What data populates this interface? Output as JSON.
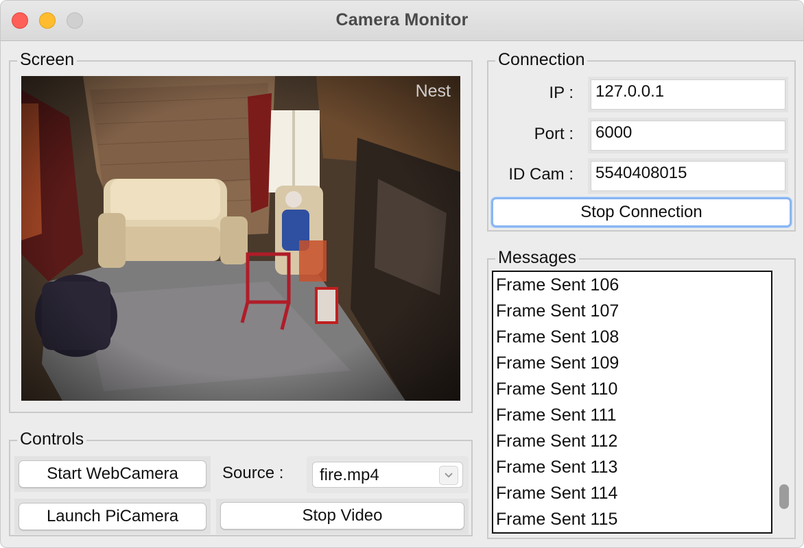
{
  "window": {
    "title": "Camera Monitor"
  },
  "screen": {
    "label": "Screen",
    "watermark": "Nest"
  },
  "controls": {
    "label": "Controls",
    "start_webcam": "Start WebCamera",
    "launch_picamera": "Launch PiCamera",
    "source_label": "Source :",
    "source_value": "fire.mp4",
    "stop_video": "Stop Video"
  },
  "connection": {
    "label": "Connection",
    "ip_label": "IP :",
    "ip_value": "127.0.0.1",
    "port_label": "Port :",
    "port_value": "6000",
    "idcam_label": "ID Cam :",
    "idcam_value": "5540408015",
    "stop_button": "Stop Connection"
  },
  "messages": {
    "label": "Messages",
    "items": [
      "Frame Sent 106",
      "Frame Sent 107",
      "Frame Sent 108",
      "Frame Sent 109",
      "Frame Sent 110",
      "Frame Sent 111",
      "Frame Sent 112",
      "Frame Sent 113",
      "Frame Sent 114",
      "Frame Sent 115"
    ]
  },
  "icons": {
    "close": "close-dot-icon",
    "minimize": "minimize-dot-icon",
    "maximize": "maximize-dot-icon",
    "dropdown": "chevron-down-icon"
  }
}
